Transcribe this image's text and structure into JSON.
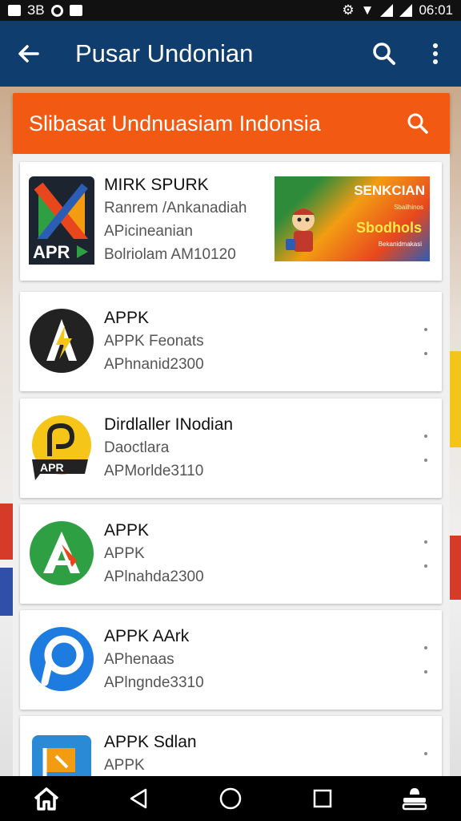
{
  "status_bar": {
    "left_text": "ЗВ",
    "time": "06:01"
  },
  "app_bar": {
    "title": "Pusar Undonian"
  },
  "search_header": {
    "title": "Slibasat Undnuasiam Indonsia"
  },
  "featured": {
    "title": "MIRK SPURK",
    "line1": "Ranrem /Ankanadiah",
    "line2": "APicineanian",
    "line3": "Bolriolam AM10120",
    "icon_label": "APR",
    "promo": {
      "headline": "SENKCIAN",
      "subline": "Sbailhinos",
      "big": "Sbodhols",
      "small": "Bekanidmakasi"
    }
  },
  "apps": [
    {
      "title": "APPK",
      "line1": "APPK Feonats",
      "line2": "APhnanid2300",
      "icon": "a-lightning-icon",
      "color": "#222222"
    },
    {
      "title": "Dirdlaller INodian",
      "line1": "Daoctlara",
      "line2": "APMorlde3110",
      "icon": "apr-chat-icon",
      "color": "#f5c518"
    },
    {
      "title": "APPK",
      "line1": "APPK",
      "line2": "APlnahda2300",
      "icon": "green-a-icon",
      "color": "#2ea043"
    },
    {
      "title": "APPK AArk",
      "line1": "APhenaas",
      "line2": "APlngnde3310",
      "icon": "blue-p-icon",
      "color": "#1e7ce0"
    },
    {
      "title": "APPK Sdlan",
      "line1": "APPK",
      "line2": "",
      "icon": "flag-icon",
      "color": "#2b8ad6"
    }
  ],
  "icons": {
    "back": "arrow-left-icon",
    "search": "search-icon",
    "more": "more-vertical-icon",
    "nav": [
      "home-icon",
      "back-triangle-icon",
      "circle-home-icon",
      "square-recents-icon",
      "profile-icon"
    ]
  },
  "colors": {
    "app_bar": "#0e3d6e",
    "header_orange": "#f25a14",
    "nav": "#000000"
  }
}
